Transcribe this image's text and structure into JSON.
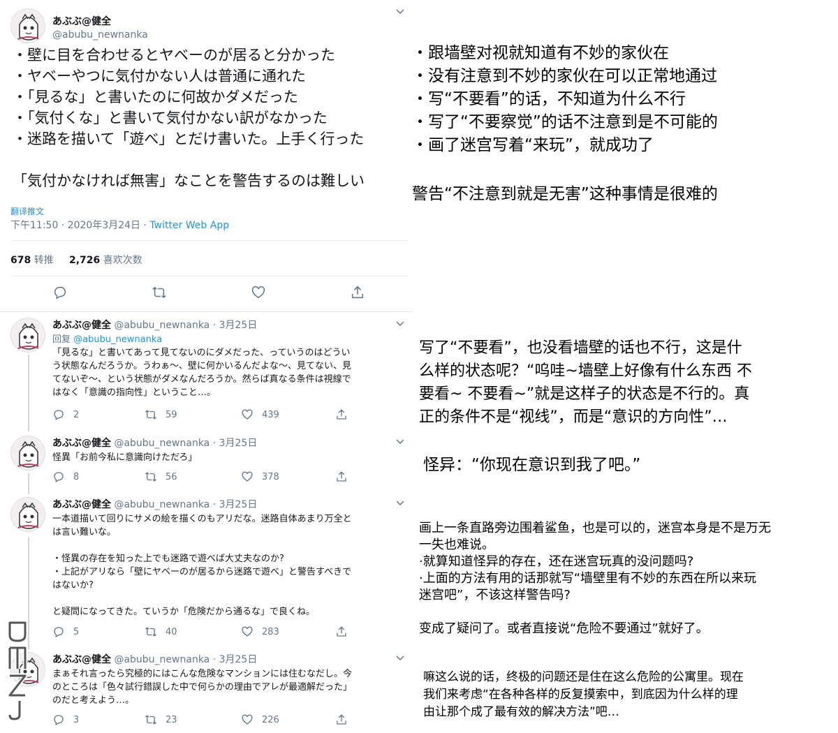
{
  "main_tweet": {
    "display_name": "あぶぶ@健全",
    "handle": "@abubu_newnanka",
    "lines": [
      "・壁に目を合わせるとヤベーのが居ると分かった",
      "・ヤベーやつに気付かない人は普通に通れた",
      "・「見るな」と書いたのに何故かダメだった",
      "・「気付くな」と書いて気付かない訳がなかった",
      "・迷路を描いて「遊べ」とだけ書いた。上手く行った"
    ],
    "closing_line": "「気付かなければ無害」なことを警告するのは難しい",
    "translate_link": "翻译推文",
    "timestamp": "下午11:50 · 2020年3月24日 · ",
    "source_app": "Twitter Web App",
    "retweets_count": "678",
    "retweets_label": "转推",
    "likes_count": "2,726",
    "likes_label": "喜欢次数"
  },
  "replies": [
    {
      "display_name": "あぶぶ@健全",
      "handle_time": "@abubu_newnanka · 3月25日",
      "replying_prefix": "回复 ",
      "replying_to": "@abubu_newnanka",
      "lines": [
        "「見るな」と書いてあって見てないのにダメだった、っていうのはどうい",
        "う状態なんだろうか。うわぁ～、壁に何かいるんだよな～、見てない、見",
        "てないぞ～、という状態がダメなんだろうか。然らば真なる条件は視線で",
        "はなく「意識の指向性」ということ…。"
      ],
      "reply_count": "2",
      "retweet_count": "59",
      "like_count": "439"
    },
    {
      "display_name": "あぶぶ@健全",
      "handle_time": "@abubu_newnanka · 3月25日",
      "lines": [
        "怪異「お前今私に意識向けただろ」"
      ],
      "reply_count": "8",
      "retweet_count": "56",
      "like_count": "378"
    },
    {
      "display_name": "あぶぶ@健全",
      "handle_time": "@abubu_newnanka · 3月25日",
      "lines": [
        "一本道描いて回りにサメの絵を描くのもアリだな。迷路自体あまり万全と",
        "は言い難いな。",
        "",
        "・怪異の存在を知った上でも迷路で遊べば大丈夫なのか?",
        "・上記がアリなら「壁にヤベーのが居るから迷路で遊べ」と警告すべきで",
        "はないか?",
        "",
        "と疑問になってきた。ていうか「危険だから通るな」で良くね。"
      ],
      "reply_count": "5",
      "retweet_count": "40",
      "like_count": "283"
    },
    {
      "display_name": "あぶぶ@健全",
      "handle_time": "@abubu_newnanka · 3月25日",
      "lines": [
        "まぁそれ言ったら究極的にはこんな危険なマンションには住むなだし。今",
        "のところは「色々試行錯誤した中で何らかの理由でアレが最適解だった」",
        "のだと考えよう…。"
      ],
      "reply_count": "3",
      "retweet_count": "23",
      "like_count": "226"
    }
  ],
  "translations": {
    "main_lines": [
      "・跟墙壁对视就知道有不妙的家伙在",
      "・没有注意到不妙的家伙在可以正常地通过",
      "・写“不要看”的话，不知道为什么不行",
      "・写了“不要察觉”的话不注意到是不可能的",
      "・画了迷宫写着“来玩”，就成功了"
    ],
    "main_closing": "警告“不注意到就是无害”这种事情是很难的",
    "reply1_lines": [
      "写了“不要看”，也没看墙壁的话也不行，这是什",
      "么样的状态呢？“呜哇~墙壁上好像有什么东西 不",
      "要看~ 不要看~”就是这样子的状态是不行的。真",
      "正的条件不是“视线”，而是“意识的方向性”…"
    ],
    "reply2": "怪异：“你现在意识到我了吧。”",
    "reply3_lines": [
      "画上一条直路旁边围着鲨鱼，也是可以的，迷宫本身是不是万无",
      "一失也难说。",
      "·就算知道怪异的存在，还在迷宫玩真的没问题吗?",
      "·上面的方法有用的话那就写“墙壁里有不妙的东西在所以来玩",
      "迷宫吧”，不该这样警告吗?"
    ],
    "reply3_closing": "变成了疑问了。或者直接说“危险不要通过”就好了。",
    "reply4_lines": [
      "嘛这么说的话，终极的问题还是住在这么危险的公寓里。现在",
      "我们来考虑“在各种各样的反复摸索中，到底因为什么样的理",
      "由让那个成了最有效的解决方法”吧…"
    ]
  },
  "watermark_text": "DMZJ.com",
  "icons": {
    "reply": "reply-icon",
    "retweet": "retweet-icon",
    "like": "heart-icon",
    "share": "share-icon",
    "menu": "chevron-down-icon"
  },
  "colors": {
    "link": "#1b95e0",
    "muted": "#657786",
    "text": "#14171a",
    "divider": "#e6ecf0"
  }
}
